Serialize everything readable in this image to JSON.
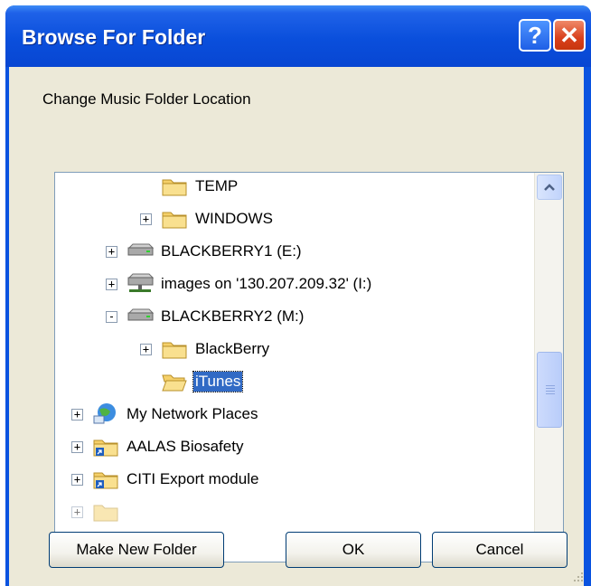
{
  "window": {
    "title": "Browse For Folder",
    "help_glyph": "?",
    "close_glyph": "✕"
  },
  "prompt": "Change Music Folder Location",
  "tree": {
    "items": [
      {
        "label": "TEMP",
        "icon": "folder-icon",
        "expander": "none",
        "selected": false
      },
      {
        "label": "WINDOWS",
        "icon": "folder-icon",
        "expander": "+",
        "selected": false
      },
      {
        "label": "BLACKBERRY1 (E:)",
        "icon": "drive-icon",
        "expander": "+",
        "selected": false
      },
      {
        "label": "images on '130.207.209.32' (I:)",
        "icon": "network-drive-icon",
        "expander": "+",
        "selected": false
      },
      {
        "label": "BLACKBERRY2 (M:)",
        "icon": "drive-icon",
        "expander": "-",
        "selected": false
      },
      {
        "label": "BlackBerry",
        "icon": "folder-icon",
        "expander": "+",
        "selected": false
      },
      {
        "label": "iTunes",
        "icon": "open-folder-icon",
        "expander": "none",
        "selected": true
      },
      {
        "label": "My Network Places",
        "icon": "network-places-icon",
        "expander": "+",
        "selected": false
      },
      {
        "label": "AALAS Biosafety",
        "icon": "shortcut-folder-icon",
        "expander": "+",
        "selected": false
      },
      {
        "label": "CITI Export module",
        "icon": "shortcut-folder-icon",
        "expander": "+",
        "selected": false
      }
    ]
  },
  "buttons": {
    "make_new_folder": "Make New Folder",
    "ok": "OK",
    "cancel": "Cancel"
  },
  "colors": {
    "titlebar": "#0a4fdc",
    "dialog_bg": "#ece9d8",
    "selection": "#316ac5",
    "folder": "#f5d06a"
  }
}
